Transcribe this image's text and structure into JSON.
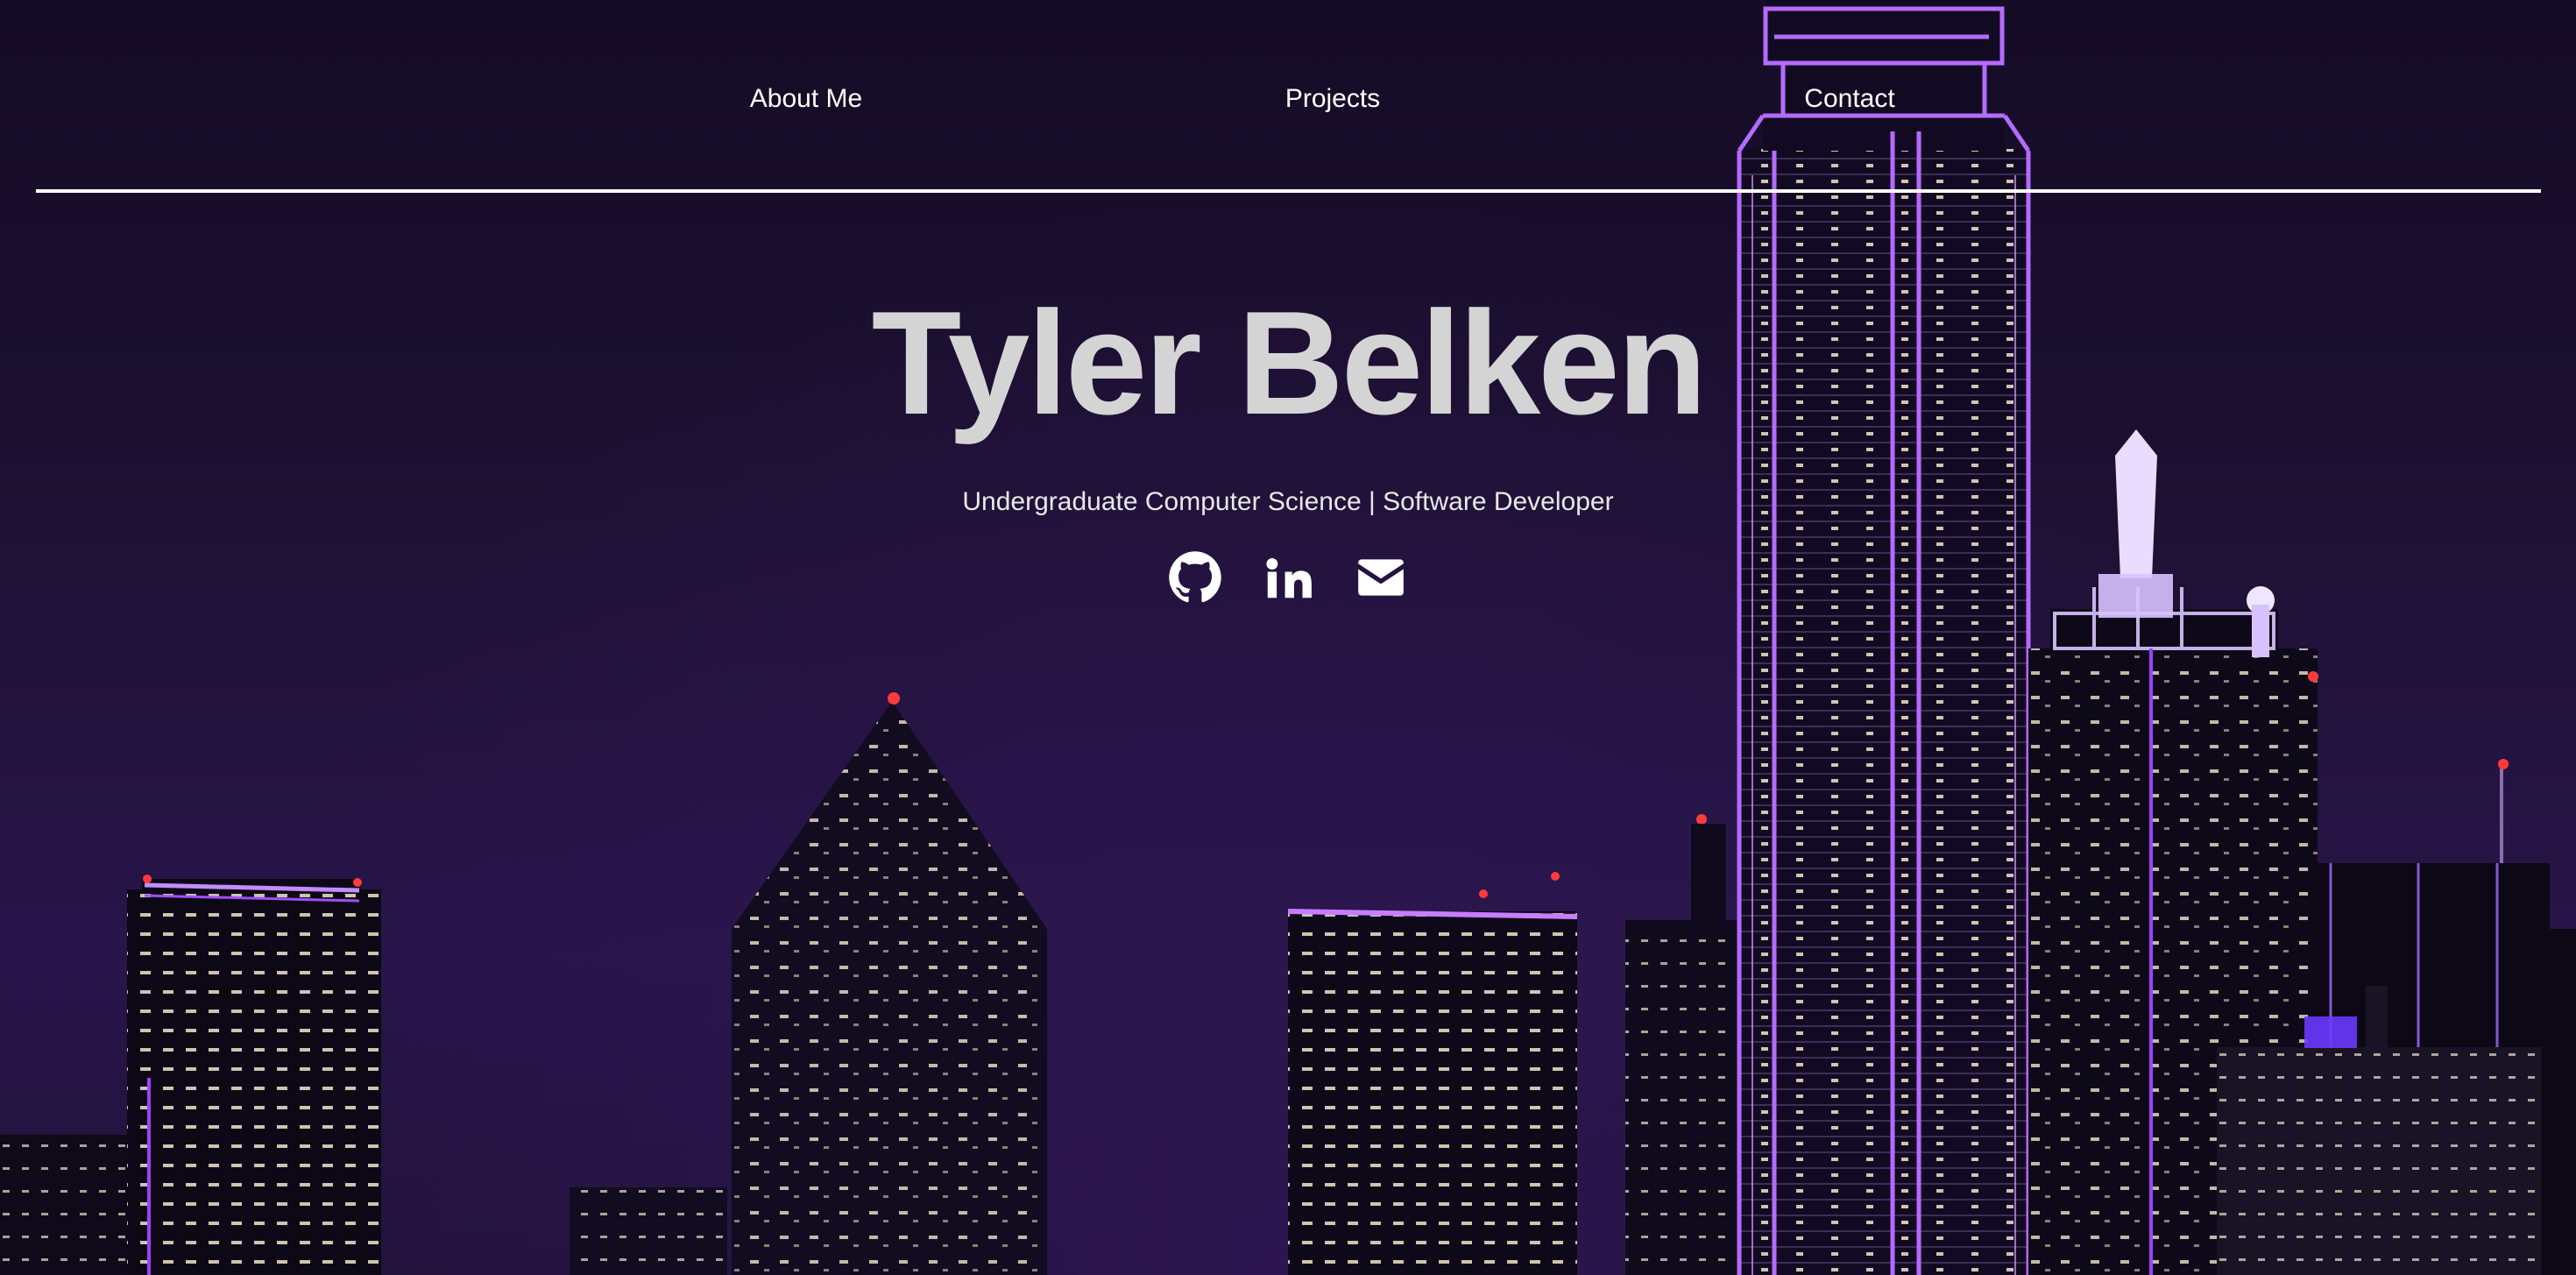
{
  "nav": {
    "items": [
      {
        "label": "About Me"
      },
      {
        "label": "Projects"
      },
      {
        "label": "Contact"
      }
    ]
  },
  "hero": {
    "name": "Tyler Belken",
    "subtitle": "Undergraduate Computer Science | Software Developer"
  },
  "socials": [
    {
      "icon": "github-icon"
    },
    {
      "icon": "linkedin-icon"
    },
    {
      "icon": "email-icon"
    }
  ],
  "colors": {
    "sky_top": "#150c26",
    "sky_bottom": "#28154a",
    "neon_purple": "#a040ff",
    "window_light": "#fff3d6",
    "beacon_red": "#ff3b3b",
    "text_primary": "#ffffff",
    "name_text": "#d4d4d4"
  }
}
